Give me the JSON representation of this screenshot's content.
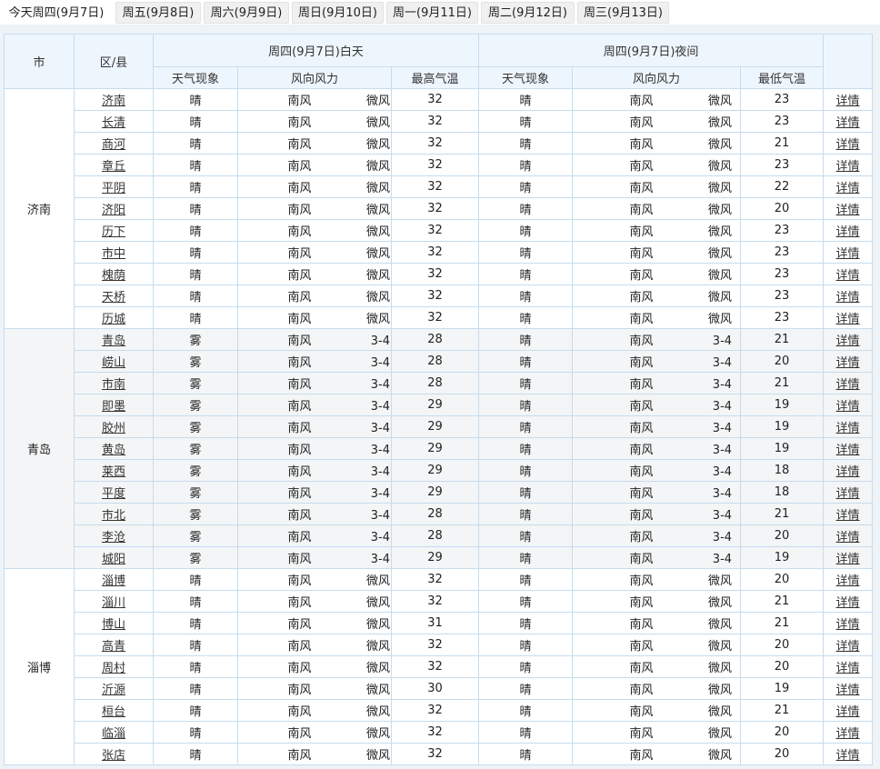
{
  "tabs": [
    {
      "label": "今天周四(9月7日)",
      "active": true
    },
    {
      "label": "周五(9月8日)"
    },
    {
      "label": "周六(9月9日)"
    },
    {
      "label": "周日(9月10日)"
    },
    {
      "label": "周一(9月11日)"
    },
    {
      "label": "周二(9月12日)"
    },
    {
      "label": "周三(9月13日)"
    }
  ],
  "headers": {
    "city": "市",
    "county": "区/县",
    "day": "周四(9月7日)白天",
    "night": "周四(9月7日)夜间",
    "weather": "天气现象",
    "wind": "风向风力",
    "high": "最高气温",
    "low": "最低气温"
  },
  "detail_label": "详情",
  "groups": [
    {
      "city": "济南",
      "rows": [
        {
          "county": "济南",
          "dw": "晴",
          "dd": "南风",
          "dp": "微风",
          "hi": "32",
          "nw": "晴",
          "nd": "南风",
          "np": "微风",
          "lo": "23"
        },
        {
          "county": "长清",
          "dw": "晴",
          "dd": "南风",
          "dp": "微风",
          "hi": "32",
          "nw": "晴",
          "nd": "南风",
          "np": "微风",
          "lo": "23"
        },
        {
          "county": "商河",
          "dw": "晴",
          "dd": "南风",
          "dp": "微风",
          "hi": "32",
          "nw": "晴",
          "nd": "南风",
          "np": "微风",
          "lo": "21"
        },
        {
          "county": "章丘",
          "dw": "晴",
          "dd": "南风",
          "dp": "微风",
          "hi": "32",
          "nw": "晴",
          "nd": "南风",
          "np": "微风",
          "lo": "23"
        },
        {
          "county": "平阴",
          "dw": "晴",
          "dd": "南风",
          "dp": "微风",
          "hi": "32",
          "nw": "晴",
          "nd": "南风",
          "np": "微风",
          "lo": "22"
        },
        {
          "county": "济阳",
          "dw": "晴",
          "dd": "南风",
          "dp": "微风",
          "hi": "32",
          "nw": "晴",
          "nd": "南风",
          "np": "微风",
          "lo": "20"
        },
        {
          "county": "历下",
          "dw": "晴",
          "dd": "南风",
          "dp": "微风",
          "hi": "32",
          "nw": "晴",
          "nd": "南风",
          "np": "微风",
          "lo": "23"
        },
        {
          "county": "市中",
          "dw": "晴",
          "dd": "南风",
          "dp": "微风",
          "hi": "32",
          "nw": "晴",
          "nd": "南风",
          "np": "微风",
          "lo": "23"
        },
        {
          "county": "槐荫",
          "dw": "晴",
          "dd": "南风",
          "dp": "微风",
          "hi": "32",
          "nw": "晴",
          "nd": "南风",
          "np": "微风",
          "lo": "23"
        },
        {
          "county": "天桥",
          "dw": "晴",
          "dd": "南风",
          "dp": "微风",
          "hi": "32",
          "nw": "晴",
          "nd": "南风",
          "np": "微风",
          "lo": "23"
        },
        {
          "county": "历城",
          "dw": "晴",
          "dd": "南风",
          "dp": "微风",
          "hi": "32",
          "nw": "晴",
          "nd": "南风",
          "np": "微风",
          "lo": "23"
        }
      ]
    },
    {
      "city": "青岛",
      "rows": [
        {
          "county": "青岛",
          "dw": "雾",
          "dd": "南风",
          "dp": "3-4",
          "hi": "28",
          "nw": "晴",
          "nd": "南风",
          "np": "3-4",
          "lo": "21"
        },
        {
          "county": "崂山",
          "dw": "雾",
          "dd": "南风",
          "dp": "3-4",
          "hi": "28",
          "nw": "晴",
          "nd": "南风",
          "np": "3-4",
          "lo": "20"
        },
        {
          "county": "市南",
          "dw": "雾",
          "dd": "南风",
          "dp": "3-4",
          "hi": "28",
          "nw": "晴",
          "nd": "南风",
          "np": "3-4",
          "lo": "21"
        },
        {
          "county": "即墨",
          "dw": "雾",
          "dd": "南风",
          "dp": "3-4",
          "hi": "29",
          "nw": "晴",
          "nd": "南风",
          "np": "3-4",
          "lo": "19"
        },
        {
          "county": "胶州",
          "dw": "雾",
          "dd": "南风",
          "dp": "3-4",
          "hi": "29",
          "nw": "晴",
          "nd": "南风",
          "np": "3-4",
          "lo": "19"
        },
        {
          "county": "黄岛",
          "dw": "雾",
          "dd": "南风",
          "dp": "3-4",
          "hi": "29",
          "nw": "晴",
          "nd": "南风",
          "np": "3-4",
          "lo": "19"
        },
        {
          "county": "莱西",
          "dw": "雾",
          "dd": "南风",
          "dp": "3-4",
          "hi": "29",
          "nw": "晴",
          "nd": "南风",
          "np": "3-4",
          "lo": "18"
        },
        {
          "county": "平度",
          "dw": "雾",
          "dd": "南风",
          "dp": "3-4",
          "hi": "29",
          "nw": "晴",
          "nd": "南风",
          "np": "3-4",
          "lo": "18"
        },
        {
          "county": "市北",
          "dw": "雾",
          "dd": "南风",
          "dp": "3-4",
          "hi": "28",
          "nw": "晴",
          "nd": "南风",
          "np": "3-4",
          "lo": "21"
        },
        {
          "county": "李沧",
          "dw": "雾",
          "dd": "南风",
          "dp": "3-4",
          "hi": "28",
          "nw": "晴",
          "nd": "南风",
          "np": "3-4",
          "lo": "20"
        },
        {
          "county": "城阳",
          "dw": "雾",
          "dd": "南风",
          "dp": "3-4",
          "hi": "29",
          "nw": "晴",
          "nd": "南风",
          "np": "3-4",
          "lo": "19"
        }
      ]
    },
    {
      "city": "淄博",
      "rows": [
        {
          "county": "淄博",
          "dw": "晴",
          "dd": "南风",
          "dp": "微风",
          "hi": "32",
          "nw": "晴",
          "nd": "南风",
          "np": "微风",
          "lo": "20"
        },
        {
          "county": "淄川",
          "dw": "晴",
          "dd": "南风",
          "dp": "微风",
          "hi": "32",
          "nw": "晴",
          "nd": "南风",
          "np": "微风",
          "lo": "21"
        },
        {
          "county": "博山",
          "dw": "晴",
          "dd": "南风",
          "dp": "微风",
          "hi": "31",
          "nw": "晴",
          "nd": "南风",
          "np": "微风",
          "lo": "21"
        },
        {
          "county": "高青",
          "dw": "晴",
          "dd": "南风",
          "dp": "微风",
          "hi": "32",
          "nw": "晴",
          "nd": "南风",
          "np": "微风",
          "lo": "20"
        },
        {
          "county": "周村",
          "dw": "晴",
          "dd": "南风",
          "dp": "微风",
          "hi": "32",
          "nw": "晴",
          "nd": "南风",
          "np": "微风",
          "lo": "20"
        },
        {
          "county": "沂源",
          "dw": "晴",
          "dd": "南风",
          "dp": "微风",
          "hi": "30",
          "nw": "晴",
          "nd": "南风",
          "np": "微风",
          "lo": "19"
        },
        {
          "county": "桓台",
          "dw": "晴",
          "dd": "南风",
          "dp": "微风",
          "hi": "32",
          "nw": "晴",
          "nd": "南风",
          "np": "微风",
          "lo": "21"
        },
        {
          "county": "临淄",
          "dw": "晴",
          "dd": "南风",
          "dp": "微风",
          "hi": "32",
          "nw": "晴",
          "nd": "南风",
          "np": "微风",
          "lo": "20"
        },
        {
          "county": "张店",
          "dw": "晴",
          "dd": "南风",
          "dp": "微风",
          "hi": "32",
          "nw": "晴",
          "nd": "南风",
          "np": "微风",
          "lo": "20"
        }
      ]
    }
  ]
}
